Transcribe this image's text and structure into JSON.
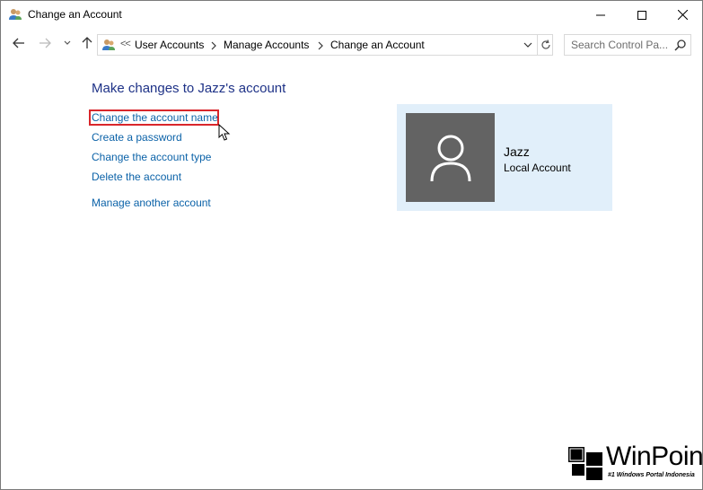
{
  "window": {
    "title": "Change an Account",
    "icon": "user-accounts-icon"
  },
  "nav": {
    "breadcrumbs": [
      "User Accounts",
      "Manage Accounts",
      "Change an Account"
    ],
    "overflow": "<<",
    "search_placeholder": "Search Control Pa..."
  },
  "content": {
    "title": "Make changes to Jazz's account",
    "links": [
      "Change the account name",
      "Create a password",
      "Change the account type",
      "Delete the account",
      "Manage another account"
    ]
  },
  "account": {
    "name": "Jazz",
    "type": "Local Account"
  },
  "watermark": {
    "brand": "WinPoin",
    "tagline": "#1 Windows Portal Indonesia"
  },
  "colors": {
    "link": "#0b62a8",
    "title": "#1e3287",
    "card_bg": "#e1effa",
    "avatar_bg": "#636363",
    "highlight": "#d9262b"
  }
}
